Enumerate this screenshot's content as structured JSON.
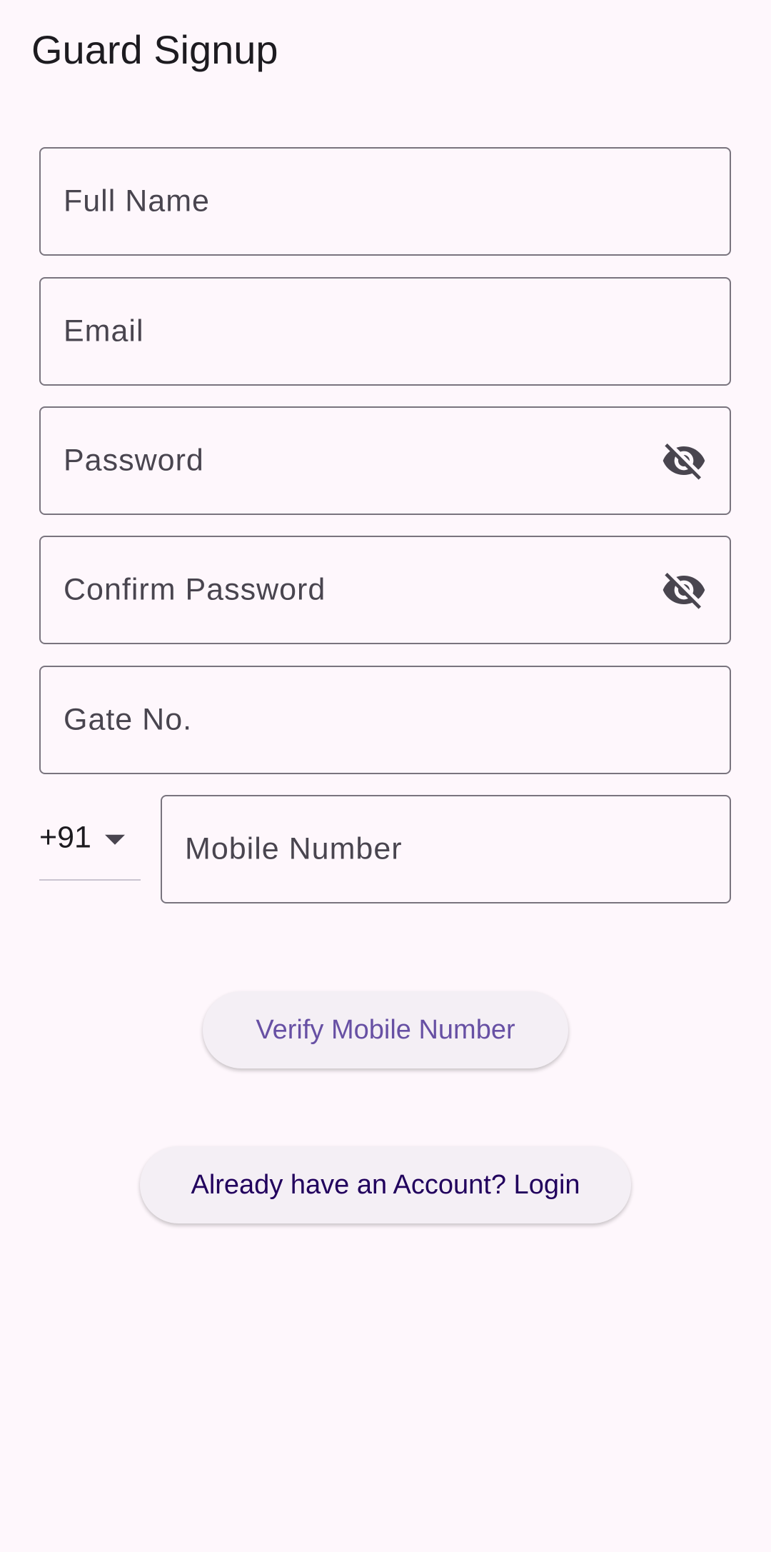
{
  "app": {
    "title": "Guard Signup"
  },
  "form": {
    "full_name": {
      "label": "Full Name",
      "value": ""
    },
    "email": {
      "label": "Email",
      "value": ""
    },
    "password": {
      "label": "Password",
      "value": "",
      "icon": "visibility-off-icon"
    },
    "confirm_password": {
      "label": "Confirm Password",
      "value": "",
      "icon": "visibility-off-icon"
    },
    "gate_no": {
      "label": "Gate No.",
      "value": ""
    },
    "country_code": {
      "selected": "+91"
    },
    "mobile_number": {
      "label": "Mobile Number",
      "value": ""
    }
  },
  "actions": {
    "verify_label": "Verify Mobile Number",
    "login_label": "Already have an Account? Login"
  },
  "colors": {
    "background": "#fef7fc",
    "outline": "#79747e",
    "primary": "#6750a4",
    "on_primary_container": "#21005d",
    "button_surface": "#f4eff5"
  }
}
